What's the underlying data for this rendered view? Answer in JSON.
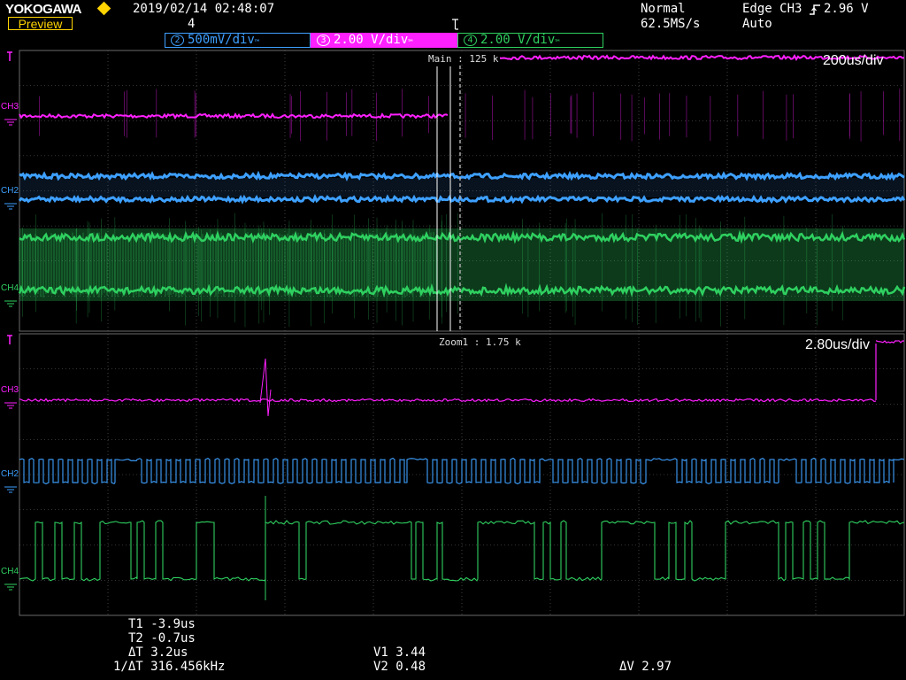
{
  "header": {
    "brand": "YOKOGAWA",
    "preview_label": "Preview",
    "datetime": "2019/02/14 02:48:07",
    "sub_value": "4",
    "acq_mode": "Normal",
    "sample_rate": "62.5MS/s",
    "trigger": "Edge CH3",
    "trigger_level": "2.96 V",
    "trigger_mode": "Auto"
  },
  "channels": [
    {
      "num": "2",
      "scale": "500mV/div",
      "color": "#3ea0ff"
    },
    {
      "num": "3",
      "scale": "2.00 V/div",
      "color": "#ff20ff"
    },
    {
      "num": "4",
      "scale": "2.00 V/div",
      "color": "#2fd060"
    }
  ],
  "main_window": {
    "label": "Main : 125 k",
    "timebase": "200us/div",
    "trace_labels": [
      "CH3",
      "CH2",
      "CH4"
    ]
  },
  "zoom_window": {
    "label": "Zoom1 : 1.75 k",
    "timebase": "2.80us/div",
    "trace_labels": [
      "CH3",
      "CH2",
      "CH4"
    ]
  },
  "cursors": {
    "t1": "T1  -3.9us",
    "t2": "T2  -0.7us",
    "dt": "ΔT  3.2us",
    "inv_dt": "1/ΔT  316.456kHz",
    "v1": "V1  3.44",
    "v2": "V2  0.48",
    "dv": "ΔV  2.97"
  },
  "colors": {
    "ch2": "#3ea0ff",
    "ch3": "#ff20ff",
    "ch4": "#2fd060",
    "grid": "#6a6a6a",
    "accent": "#ffd400"
  }
}
